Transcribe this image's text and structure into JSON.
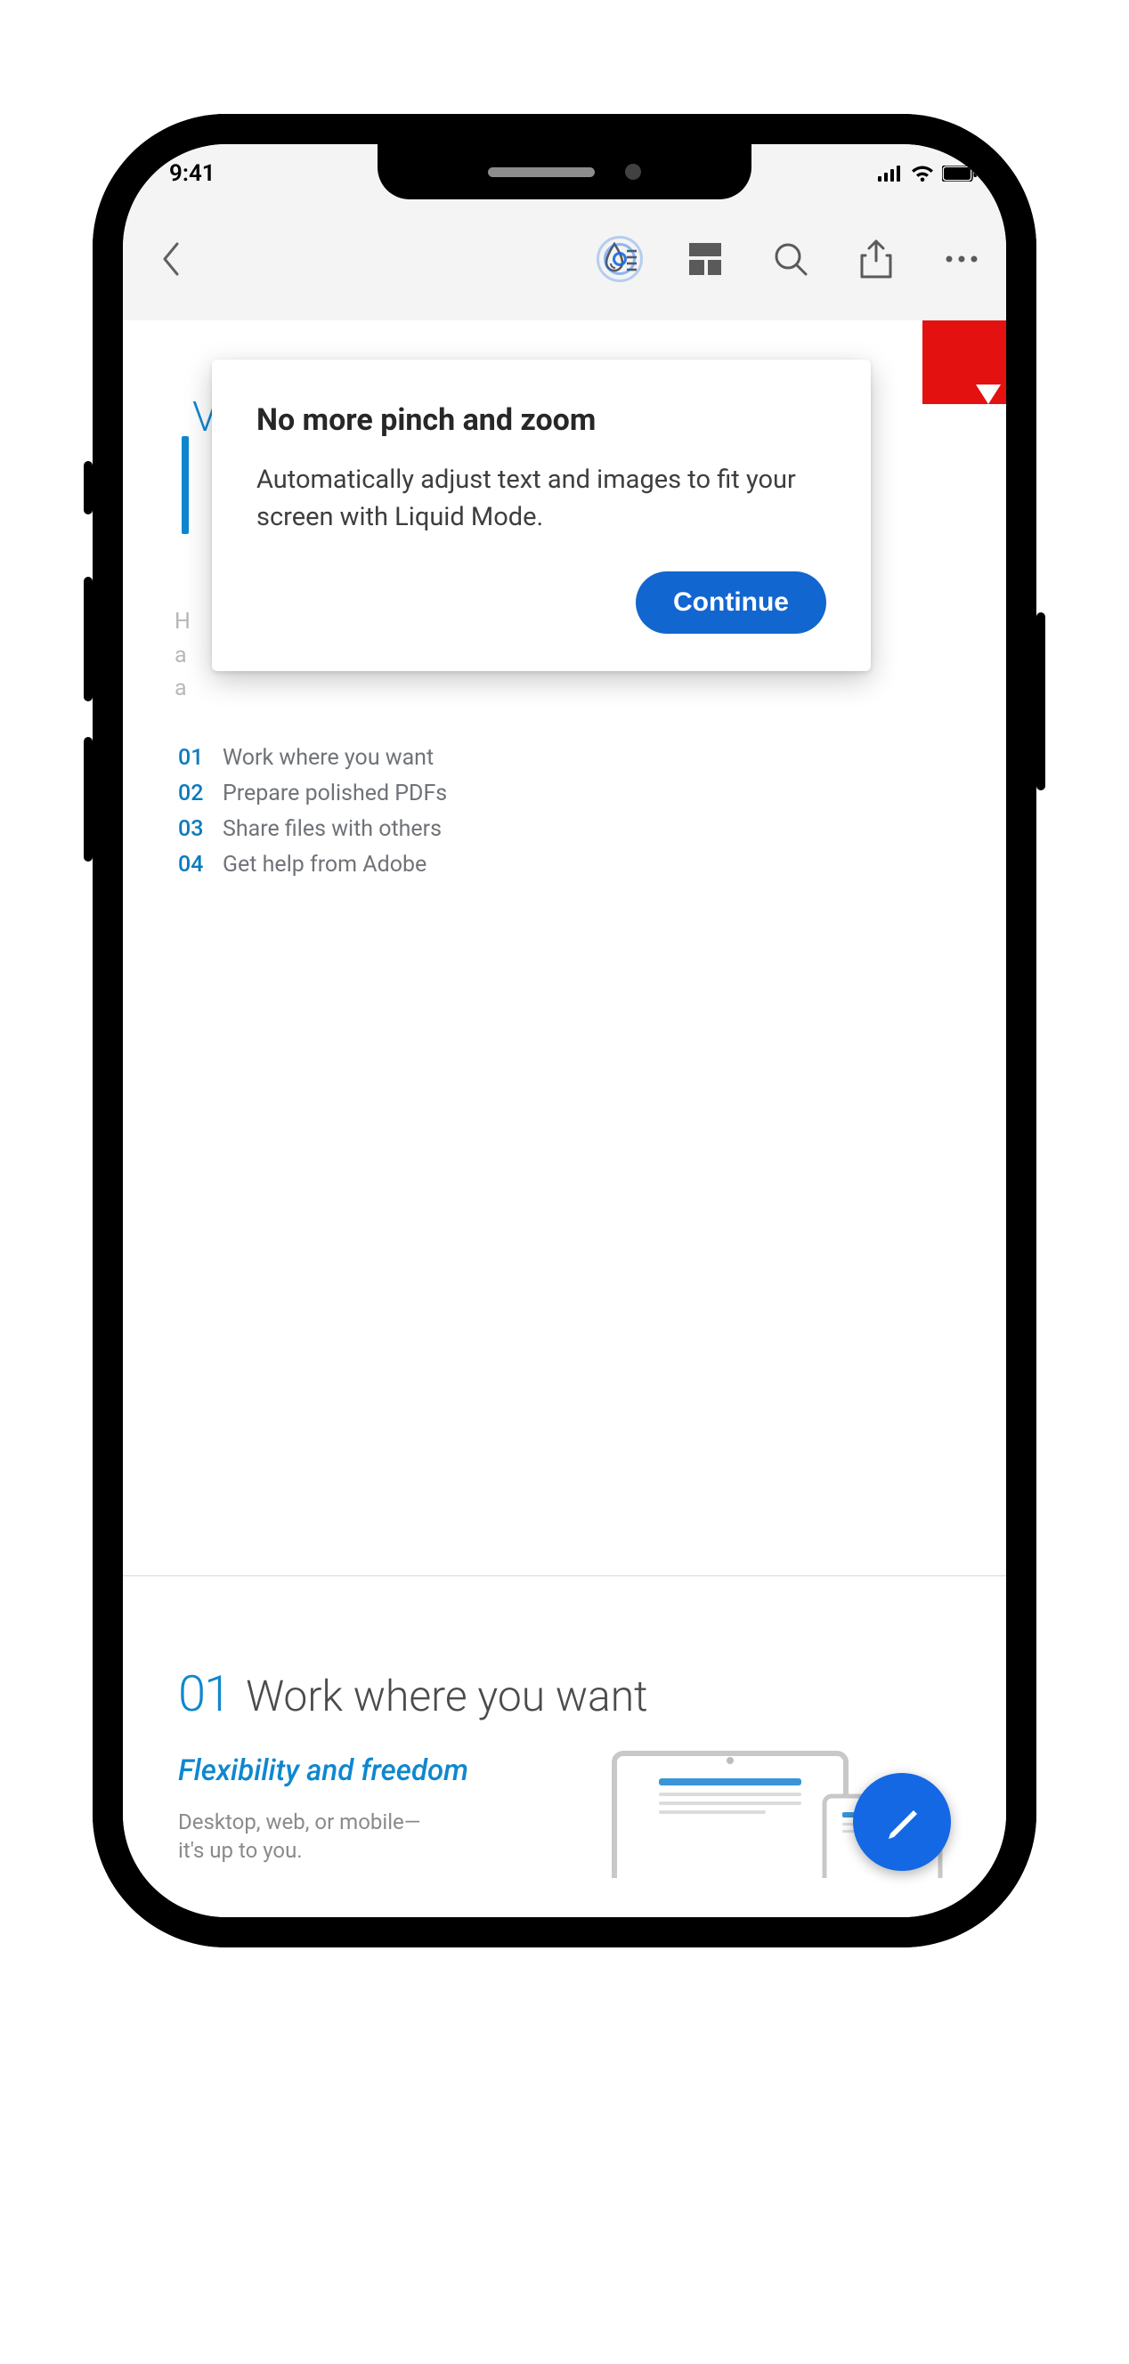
{
  "status_bar": {
    "time": "9:41"
  },
  "toolbar": {
    "back_label": "Back",
    "liquid_label": "Liquid Mode",
    "pages_label": "Page view",
    "search_label": "Search",
    "share_label": "Share",
    "more_label": "More"
  },
  "popover": {
    "title": "No more pinch and zoom",
    "body": "Automatically adjust text and images to fit your screen with Liquid Mode.",
    "button": "Continue"
  },
  "behind_text": {
    "welcome_initial": "V",
    "line1": "H",
    "line2": "a",
    "line3": "a"
  },
  "toc": {
    "items": [
      {
        "num": "01",
        "text": "Work where you want"
      },
      {
        "num": "02",
        "text": "Prepare polished PDFs"
      },
      {
        "num": "03",
        "text": "Share files with others"
      },
      {
        "num": "04",
        "text": "Get help from Adobe"
      }
    ]
  },
  "section": {
    "num": "01",
    "title": "Work where you want",
    "subtitle": "Flexibility and freedom",
    "body": "Desktop, web, or mobile—it's up to you."
  },
  "fab": {
    "label": "Edit"
  }
}
